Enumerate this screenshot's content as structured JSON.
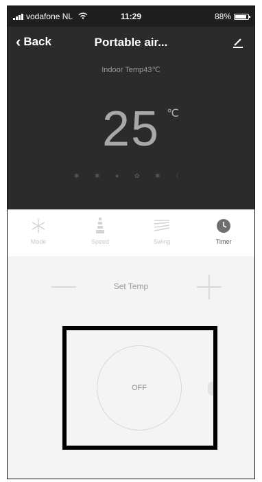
{
  "status_bar": {
    "carrier": "vodafone NL",
    "time": "11:29",
    "battery": "88%",
    "battery_level": 0.88
  },
  "nav": {
    "back_label": "Back",
    "title": "Portable air..."
  },
  "display": {
    "indoor_temp": "Indoor Temp43℃",
    "temperature": "25",
    "unit": "℃"
  },
  "controls": [
    {
      "label": "Mode",
      "icon": "snowflake-icon"
    },
    {
      "label": "Speed",
      "icon": "fan-speed-icon"
    },
    {
      "label": "Swing",
      "icon": "swing-icon"
    },
    {
      "label": "Timer",
      "icon": "clock-icon"
    }
  ],
  "set_temp": {
    "label": "Set Temp"
  },
  "power": {
    "label": "OFF"
  }
}
